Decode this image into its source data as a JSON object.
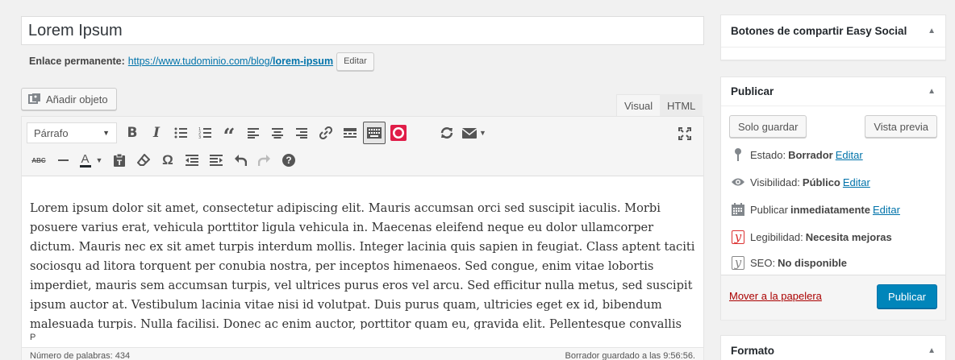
{
  "post": {
    "title": "Lorem Ipsum",
    "permalink_label": "Enlace permanente:",
    "permalink_base": "https://www.tudominio.com/blog/",
    "permalink_slug": "lorem-ipsum",
    "edit_label": "Editar"
  },
  "editor": {
    "add_media_label": "Añadir objeto",
    "tab_visual": "Visual",
    "tab_html": "HTML",
    "format_select": "Párrafo",
    "body": "Lorem ipsum dolor sit amet, consectetur adipiscing elit. Mauris accumsan orci sed suscipit iaculis. Morbi posuere varius erat, vehicula porttitor ligula vehicula in. Maecenas eleifend neque eu dolor ullamcorper dictum. Mauris nec ex sit amet turpis interdum mollis. Integer lacinia quis sapien in feugiat. Class aptent taciti sociosqu ad litora torquent per conubia nostra, per inceptos himenaeos. Sed congue, enim vitae lobortis imperdiet, mauris sem accumsan turpis, vel ultrices purus eros vel arcu. Sed efficitur nulla metus, sed suscipit ipsum auctor at. Vestibulum lacinia vitae nisi id volutpat. Duis purus quam, ultricies eget ex id, bibendum malesuada turpis. Nulla facilisi. Donec ac enim auctor, porttitor quam eu, gravida elit. Pellentesque convallis arcu luctus urna sodales, quis sodales ligula",
    "path": "P",
    "word_count": "Número de palabras: 434",
    "draft_saved": "Borrador guardado a las 9:56:56."
  },
  "sidebar": {
    "share_box_title": "Botones de compartir Easy Social",
    "publish_box": {
      "title": "Publicar",
      "save_draft": "Solo guardar",
      "preview": "Vista previa",
      "status_label": "Estado:",
      "status_value": "Borrador",
      "visibility_label": "Visibilidad:",
      "visibility_value": "Público",
      "schedule_label": "Publicar",
      "schedule_value": "inmediatamente",
      "edit": "Editar",
      "readability_label": "Legibilidad:",
      "readability_value": "Necesita mejoras",
      "seo_label": "SEO:",
      "seo_value": "No disponible",
      "trash": "Mover a la papelera",
      "publish": "Publicar"
    },
    "format_box_title": "Formato"
  },
  "colors": {
    "accent": "#0073aa",
    "publish_button": "#0085ba",
    "trash_link": "#aa0000",
    "readability_bad": "#dc3232"
  }
}
